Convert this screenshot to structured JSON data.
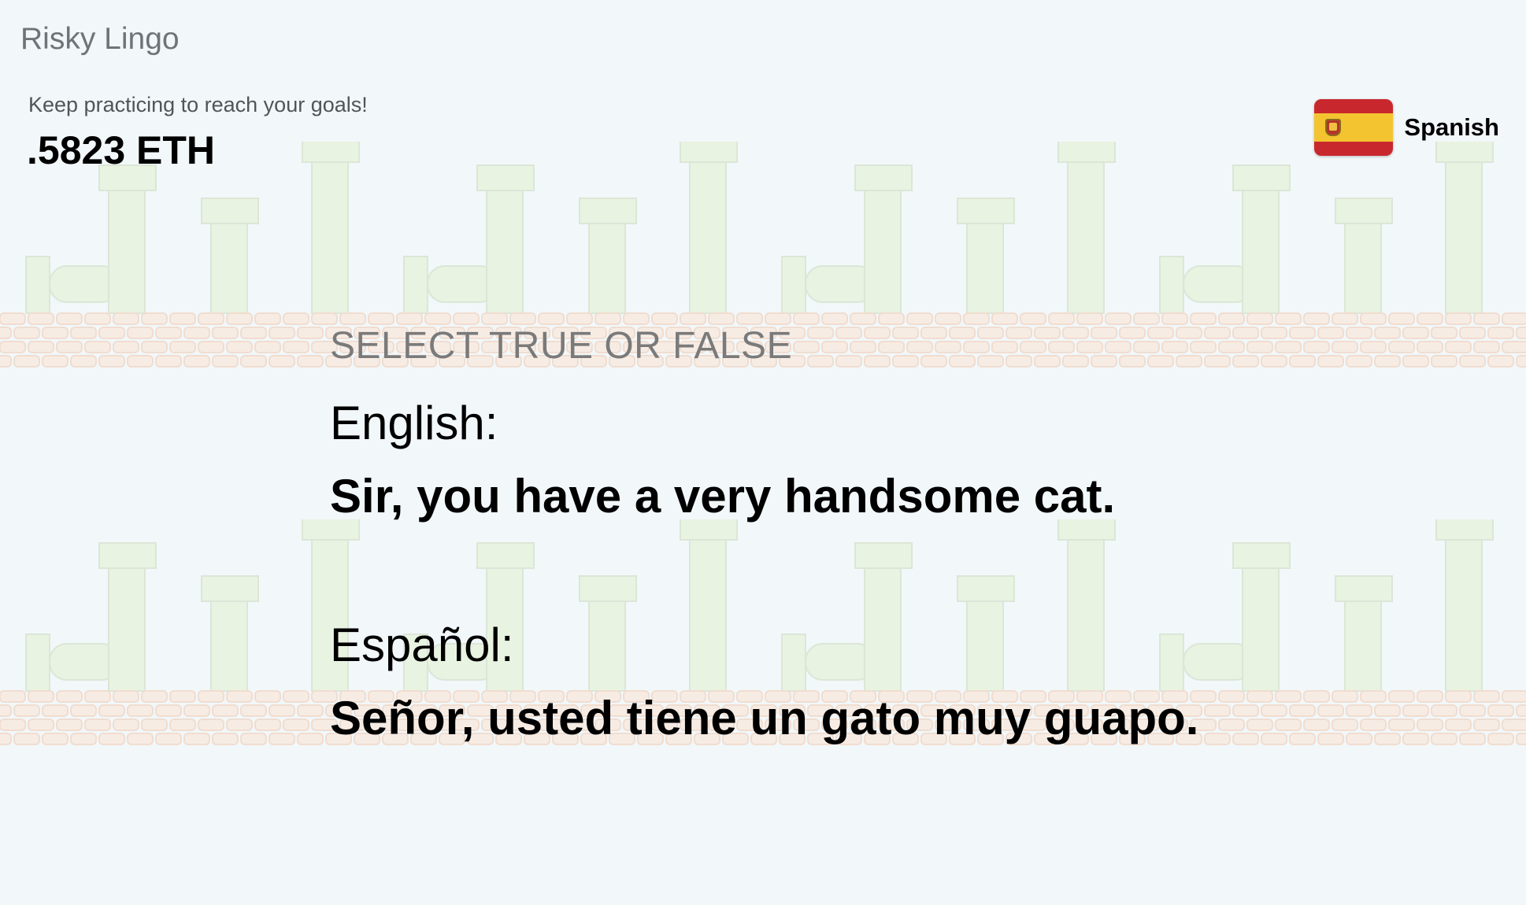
{
  "app": {
    "title": "Risky Lingo"
  },
  "header": {
    "tagline": "Keep practicing to reach your goals!",
    "balance": ".5823 ETH"
  },
  "language": {
    "icon": "spain-flag-icon",
    "label": "Spanish"
  },
  "question": {
    "instruction": "SELECT TRUE OR FALSE",
    "source_label": "English:",
    "source_sentence": "Sir, you have a very handsome cat.",
    "target_label": "Español:",
    "target_sentence": "Señor, usted tiene un gato muy guapo."
  },
  "colors": {
    "background": "#f2f7f9",
    "pipe_fill": "#e8f3e1",
    "pipe_stroke": "#dce6d8",
    "brick_fill": "#f7ece4",
    "brick_stroke": "#f0ddd0",
    "flag_red": "#c8282d",
    "flag_yellow": "#f4c430"
  }
}
